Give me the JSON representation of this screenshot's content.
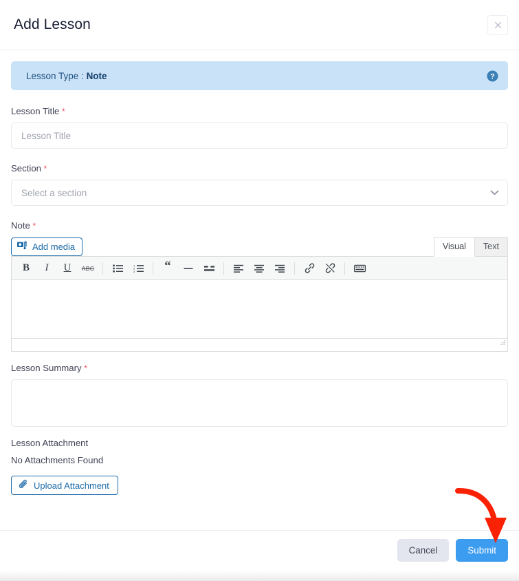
{
  "modal": {
    "title": "Add Lesson",
    "close_icon": "close-icon"
  },
  "alert": {
    "prefix": "Lesson Type : ",
    "value": "Note",
    "help_icon": "help-circle-icon",
    "bg_color": "#c9e2f7",
    "text_color": "#1c4d7c"
  },
  "fields": {
    "lesson_title": {
      "label": "Lesson Title",
      "required_mark": "*",
      "placeholder": "Lesson Title",
      "value": ""
    },
    "section": {
      "label": "Section",
      "required_mark": "*",
      "placeholder": "Select a section",
      "selected": "Select a section",
      "chevron_icon": "chevron-down-icon"
    },
    "note": {
      "label": "Note",
      "required_mark": "*",
      "add_media_label": "Add media",
      "add_media_icon": "media-icon",
      "tabs": [
        {
          "label": "Visual",
          "active": true
        },
        {
          "label": "Text",
          "active": false
        }
      ],
      "toolbar": [
        {
          "name": "bold-icon",
          "glyph": "B"
        },
        {
          "name": "italic-icon",
          "glyph": "I"
        },
        {
          "name": "underline-icon",
          "glyph": "U"
        },
        {
          "name": "strikethrough-icon",
          "glyph": "ABC"
        },
        {
          "name": "bullet-list-icon",
          "glyph": ""
        },
        {
          "name": "numbered-list-icon",
          "glyph": ""
        },
        {
          "name": "blockquote-icon",
          "glyph": ""
        },
        {
          "name": "horizontal-rule-icon",
          "glyph": ""
        },
        {
          "name": "insert-read-more-icon",
          "glyph": ""
        },
        {
          "name": "align-left-icon",
          "glyph": ""
        },
        {
          "name": "align-center-icon",
          "glyph": ""
        },
        {
          "name": "align-right-icon",
          "glyph": ""
        },
        {
          "name": "insert-link-icon",
          "glyph": ""
        },
        {
          "name": "remove-link-icon",
          "glyph": ""
        },
        {
          "name": "toolbar-toggle-icon",
          "glyph": ""
        }
      ],
      "content": ""
    },
    "lesson_summary": {
      "label": "Lesson Summary",
      "required_mark": "*",
      "value": ""
    },
    "lesson_attachment": {
      "label": "Lesson Attachment",
      "empty_text": "No Attachments Found",
      "upload_label": "Upload Attachment",
      "upload_icon": "paperclip-icon"
    }
  },
  "footer": {
    "cancel_label": "Cancel",
    "submit_label": "Submit",
    "submit_color": "#3c9cf0",
    "cancel_color": "#e4e6ef"
  },
  "annotation": {
    "arrow_color": "#fb2105",
    "points_to": "Submit"
  }
}
